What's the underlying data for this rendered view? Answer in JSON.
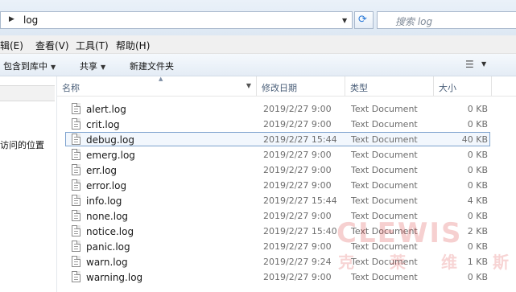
{
  "address": {
    "path": "log"
  },
  "search": {
    "placeholder": "搜索 log"
  },
  "menu": [
    {
      "label": "编辑(E)"
    },
    {
      "label": "查看(V)"
    },
    {
      "label": "工具(T)"
    },
    {
      "label": "帮助(H)"
    }
  ],
  "toolbar": {
    "include_label": "包含到库中",
    "share_label": "共享",
    "new_folder_label": "新建文件夹"
  },
  "nav": {
    "recent_places": "访问的位置"
  },
  "columns": {
    "name": "名称",
    "date": "修改日期",
    "type": "类型",
    "size": "大小"
  },
  "files": [
    {
      "name": "alert.log",
      "date": "2019/2/27 9:00",
      "type": "Text Document",
      "size": "0 KB"
    },
    {
      "name": "crit.log",
      "date": "2019/2/27 9:00",
      "type": "Text Document",
      "size": "0 KB"
    },
    {
      "name": "debug.log",
      "date": "2019/2/27 15:44",
      "type": "Text Document",
      "size": "40 KB"
    },
    {
      "name": "emerg.log",
      "date": "2019/2/27 9:00",
      "type": "Text Document",
      "size": "0 KB"
    },
    {
      "name": "err.log",
      "date": "2019/2/27 9:00",
      "type": "Text Document",
      "size": "0 KB"
    },
    {
      "name": "error.log",
      "date": "2019/2/27 9:00",
      "type": "Text Document",
      "size": "0 KB"
    },
    {
      "name": "info.log",
      "date": "2019/2/27 15:44",
      "type": "Text Document",
      "size": "4 KB"
    },
    {
      "name": "none.log",
      "date": "2019/2/27 9:00",
      "type": "Text Document",
      "size": "0 KB"
    },
    {
      "name": "notice.log",
      "date": "2019/2/27 15:40",
      "type": "Text Document",
      "size": "2 KB"
    },
    {
      "name": "panic.log",
      "date": "2019/2/27 9:00",
      "type": "Text Document",
      "size": "0 KB"
    },
    {
      "name": "warn.log",
      "date": "2019/2/27 9:24",
      "type": "Text Document",
      "size": "1 KB"
    },
    {
      "name": "warning.log",
      "date": "2019/2/27 9:00",
      "type": "Text Document",
      "size": "0 KB"
    }
  ],
  "watermark": {
    "latin": "CLEWIS",
    "chinese": "克莱维斯"
  }
}
